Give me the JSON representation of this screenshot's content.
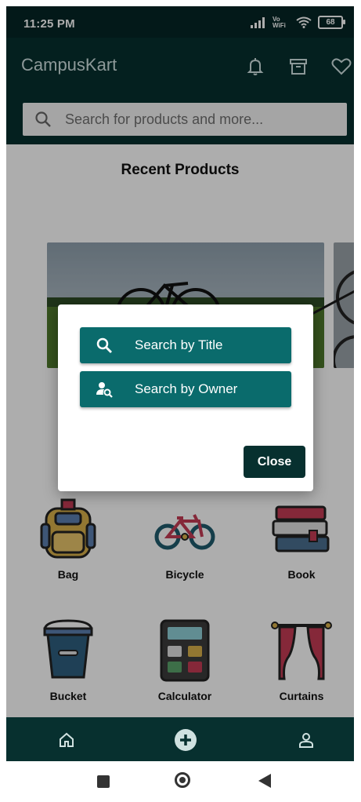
{
  "status": {
    "time": "11:25 PM",
    "network": "Vo WiFi",
    "battery": "68"
  },
  "app": {
    "title": "CampusKart"
  },
  "header_icons": [
    "bell-icon",
    "archive-icon",
    "heart-icon"
  ],
  "search": {
    "placeholder": "Search for products and more..."
  },
  "recent": {
    "title": "Recent Products"
  },
  "categories": [
    {
      "label": "Bag",
      "icon": "bag-icon"
    },
    {
      "label": "Bicycle",
      "icon": "bicycle-icon"
    },
    {
      "label": "Book",
      "icon": "book-icon"
    },
    {
      "label": "Bucket",
      "icon": "bucket-icon"
    },
    {
      "label": "Calculator",
      "icon": "calculator-icon"
    },
    {
      "label": "Curtains",
      "icon": "curtains-icon"
    }
  ],
  "dialog": {
    "search_title": "Search by Title",
    "search_owner": "Search by Owner",
    "close": "Close"
  },
  "bottom_nav": [
    "home-icon",
    "add-icon",
    "profile-icon"
  ],
  "colors": {
    "primary_dark": "#07302f",
    "primary": "#0a6b6c",
    "status_bar": "#052626"
  }
}
